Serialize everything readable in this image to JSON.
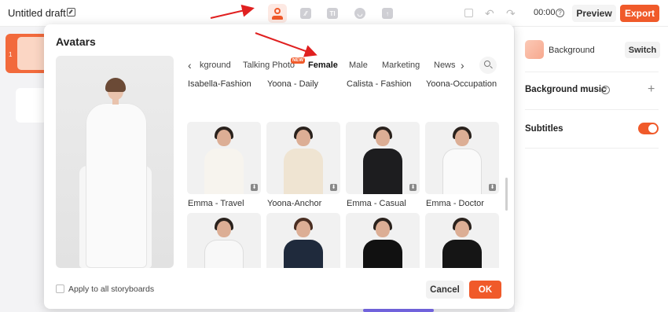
{
  "topbar": {
    "draft_title": "Untitled draft",
    "timer": "00:00",
    "preview_label": "Preview",
    "export_label": "Export",
    "help_glyph": "?"
  },
  "toolbar": {
    "tools": [
      "avatar-icon",
      "ratio-icon",
      "text-icon",
      "sticker-icon",
      "upload-icon"
    ],
    "text_glyph": "TI"
  },
  "storyboard": {
    "first_number": "1"
  },
  "right_panel": {
    "background_label": "Background",
    "switch_label": "Switch",
    "background_music_label": "Background music",
    "help_glyph": "?",
    "add_glyph": "+",
    "subtitles_label": "Subtitles",
    "subtitles_on": true
  },
  "modal": {
    "title": "Avatars",
    "tabs": [
      {
        "label": "kground",
        "active": false
      },
      {
        "label": "Talking Photo",
        "active": false,
        "badge": "NEW"
      },
      {
        "label": "Female",
        "active": true
      },
      {
        "label": "Male",
        "active": false
      },
      {
        "label": "Marketing",
        "active": false
      },
      {
        "label": "News",
        "active": false
      }
    ],
    "prev_glyph": "‹",
    "next_glyph": "›",
    "top_row_names": [
      "Isabella-Fashion",
      "Yoona - Daily",
      "Calista - Fashion",
      "Yoona-Occupation"
    ],
    "row1_names": [
      "Emma - Travel",
      "Yoona-Anchor",
      "Emma - Casual",
      "Emma - Doctor"
    ],
    "download_glyph": "⬇",
    "apply_label": "Apply to all storyboards",
    "cancel_label": "Cancel",
    "ok_label": "OK"
  },
  "colors": {
    "accent": "#f05a2a",
    "accent_light": "#fde9e3",
    "annotation_arrow": "#e02020"
  }
}
